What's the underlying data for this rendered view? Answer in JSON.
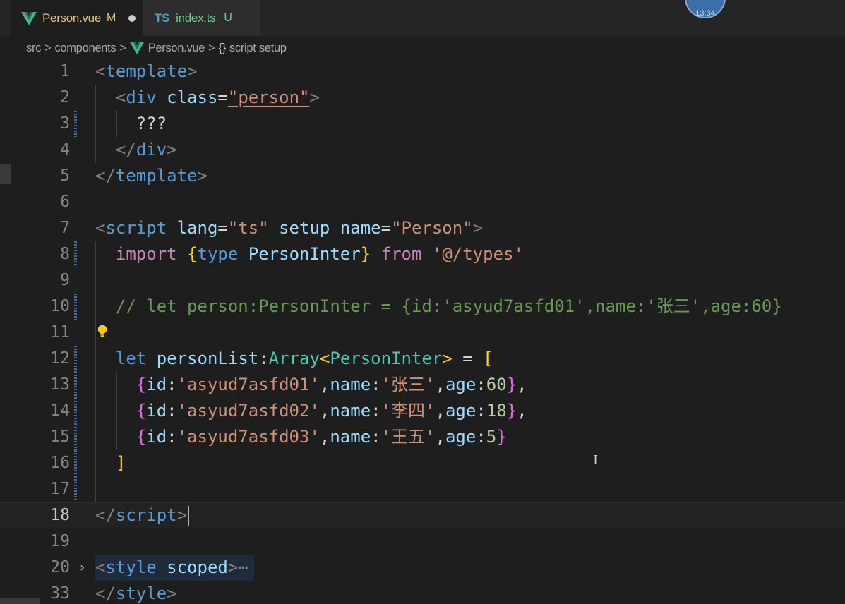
{
  "tabs": [
    {
      "name": "Person.vue",
      "status": "M",
      "active": true
    },
    {
      "icon": "TS",
      "name": "index.ts",
      "status": "U",
      "active": false
    }
  ],
  "avatar_text": "13:34",
  "breadcrumb": {
    "items": [
      "src",
      "components",
      "Person.vue",
      "script setup"
    ],
    "separator": ">",
    "braces": "{}"
  },
  "editor": {
    "line_numbers": [
      "1",
      "2",
      "3",
      "4",
      "5",
      "6",
      "7",
      "8",
      "9",
      "10",
      "11",
      "12",
      "13",
      "14",
      "15",
      "16",
      "17",
      "18",
      "19",
      "20",
      "33"
    ],
    "current_line": "18",
    "lines": {
      "l1": [
        "<",
        "template",
        ">"
      ],
      "l2": [
        "<",
        "div",
        "class",
        "=",
        "\"person\"",
        ">"
      ],
      "l3": [
        "???"
      ],
      "l4": [
        "</",
        "div",
        ">"
      ],
      "l5": [
        "</",
        "template",
        ">"
      ],
      "l7": [
        "<",
        "script",
        "lang",
        "=",
        "\"ts\"",
        "setup",
        "name",
        "=",
        "\"Person\"",
        ">"
      ],
      "l8": [
        "import",
        "{",
        "type",
        "PersonInter",
        "}",
        "from",
        "'@/types'"
      ],
      "l10": [
        "// let person:PersonInter = {id:'asyud7asfd01',name:'张三',age:60}"
      ],
      "l12": [
        "let",
        "personList",
        ":",
        "Array",
        "<",
        "PersonInter",
        ">",
        " = ",
        "["
      ],
      "l13": [
        "{",
        "id",
        ":",
        "'asyud7asfd01'",
        ",",
        "name",
        ":",
        "'张三'",
        ",",
        "age",
        ":",
        "60",
        "}",
        ","
      ],
      "l14": [
        "{",
        "id",
        ":",
        "'asyud7asfd02'",
        ",",
        "name",
        ":",
        "'李四'",
        ",",
        "age",
        ":",
        "18",
        "}",
        ","
      ],
      "l15": [
        "{",
        "id",
        ":",
        "'asyud7asfd03'",
        ",",
        "name",
        ":",
        "'王五'",
        ",",
        "age",
        ":",
        "5",
        "}"
      ],
      "l16": [
        "]"
      ],
      "l18": [
        "</",
        "script",
        ">"
      ],
      "l20": [
        "<",
        "style",
        "scoped",
        ">",
        "⋯"
      ],
      "l33": [
        "</",
        "style",
        ">"
      ]
    },
    "fold_chevron": "›",
    "ibeam": "I"
  },
  "colors": {
    "background": "#1e1e1e",
    "tag": "#569cd6",
    "attribute": "#9cdcfe",
    "string": "#ce9178",
    "keyword": "#c586c0",
    "type": "#4ec9b0",
    "comment": "#6a9955",
    "number": "#b5cea8",
    "modified_tab": "#e2c08d",
    "untracked_tab": "#73c991"
  },
  "icons": [
    "vue-icon",
    "typescript-icon",
    "lightbulb-icon",
    "chevron-right-icon",
    "dirty-indicator-icon"
  ]
}
